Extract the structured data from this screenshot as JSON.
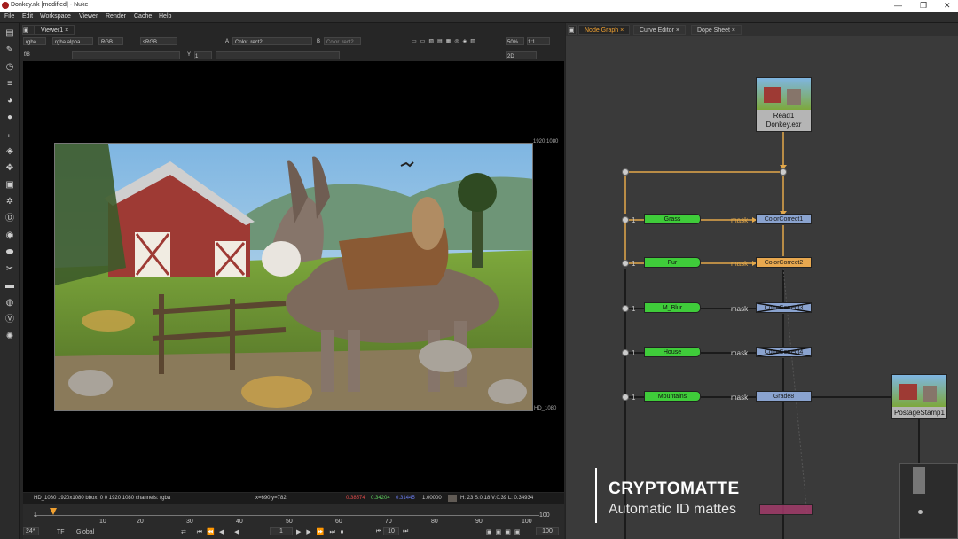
{
  "window": {
    "title": "Donkey.nk [modified] - Nuke"
  },
  "menu": [
    "File",
    "Edit",
    "Workspace",
    "Viewer",
    "Render",
    "Cache",
    "Help"
  ],
  "viewer": {
    "tab": "Viewer1",
    "channels": "rgba",
    "alpha": "rgba.alpha",
    "colorspace": "RGB",
    "display": "sRGB",
    "input_a": "Color..rect2",
    "input_b": "Color..rect2",
    "zoom": "50%",
    "proxy": "1:1",
    "fstop": "f/8",
    "frame_y": "1",
    "view_mode": "2D",
    "format_tr": "1920,1080",
    "format_br": "HD_1080",
    "info": "HD_1080 1920x1080  bbox: 0 0 1920 1080 channels: rgba",
    "coords": "x=690 y=782",
    "pixel_r": "0.38574",
    "pixel_g": "0.34204",
    "pixel_b": "0.31445",
    "pixel_a": "1.00000",
    "hsv": "H: 23 S:0.18 V:0.39  L: 0.34934"
  },
  "timeline": {
    "ticks": [
      "1",
      "10",
      "20",
      "30",
      "40",
      "50",
      "60",
      "70",
      "80",
      "90",
      "100"
    ],
    "end": "100",
    "fps": "24*",
    "tf": "TF",
    "global": "Global",
    "frame": "1",
    "step": "10",
    "out": "100"
  },
  "graph": {
    "tabs": [
      "Node Graph",
      "Curve Editor",
      "Dope Sheet"
    ],
    "read_node": {
      "name": "Read1",
      "file": "Donkey.exr"
    },
    "stamp": "PostageStamp1",
    "rows": [
      {
        "matte": "Grass",
        "target": "ColorCorrect1",
        "mask": "mask",
        "style": "cc"
      },
      {
        "matte": "Fur",
        "target": "ColorCorrect2",
        "mask": "mask",
        "style": "cc2"
      },
      {
        "matte": "M_Blur",
        "target": "ColorCorrect3",
        "mask": "mask",
        "style": "disabled"
      },
      {
        "matte": "House",
        "target": "ColorCorrect4",
        "mask": "mask",
        "style": "disabled"
      },
      {
        "matte": "Mountains",
        "target": "Grade8",
        "mask": "mask",
        "style": "cc"
      }
    ]
  },
  "caption": {
    "title": "CRYPTOMATTE",
    "subtitle": "Automatic ID mattes"
  },
  "colors": {
    "accent": "#f0a030",
    "matte": "#3fcc3a",
    "cc_node": "#8aa3cf",
    "cc_selected": "#e8a84f",
    "pipe": "#e3a84a"
  }
}
